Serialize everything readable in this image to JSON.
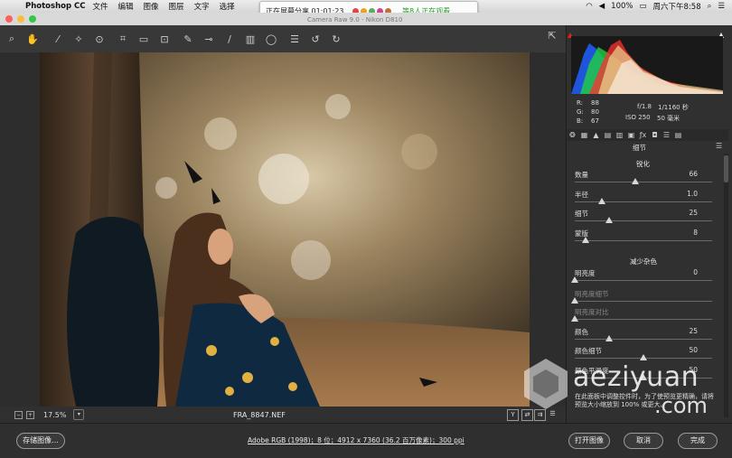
{
  "menubar": {
    "app": "Photoshop CC",
    "items": [
      "文件",
      "编辑",
      "图像",
      "图层",
      "文字",
      "选择"
    ],
    "battery": "100%",
    "clock": "周六下午8:58"
  },
  "share": {
    "text": "正在屏幕分享 01:01:23",
    "viewers": "...等8人正在观看"
  },
  "window": {
    "title": "Camera Raw 9.0 - Nikon D810"
  },
  "toolbar": {
    "tools": [
      "zoom-icon",
      "hand-icon",
      "white-balance-icon",
      "color-sampler-icon",
      "targeted-adjust-icon",
      "crop-icon",
      "straighten-icon",
      "transform-icon",
      "spot-removal-icon",
      "red-eye-icon",
      "adjustment-brush-icon",
      "graduated-filter-icon",
      "radial-filter-icon",
      "presets-list-icon",
      "rotate-left-icon",
      "rotate-right-icon"
    ],
    "fullscreen_icon": "fullscreen-icon"
  },
  "status": {
    "zoom": "17.5%",
    "filename": "FRA_8847.NEF",
    "y_label": "Y"
  },
  "exif": {
    "r_label": "R:",
    "r_val": "88",
    "g_label": "G:",
    "g_val": "80",
    "b_label": "B:",
    "b_val": "67",
    "aperture": "f/1.8",
    "shutter": "1/1160 秒",
    "iso": "ISO 250",
    "focal": "50 毫米"
  },
  "panel": {
    "title": "细节",
    "sharpen_heading": "锐化",
    "noise_heading": "减少杂色",
    "sliders": [
      {
        "name": "数量",
        "value": "66",
        "pos": 0.44
      },
      {
        "name": "半径",
        "value": "1.0",
        "pos": 0.2
      },
      {
        "name": "细节",
        "value": "25",
        "pos": 0.25
      },
      {
        "name": "蒙版",
        "value": "8",
        "pos": 0.08
      }
    ],
    "noise_sliders": [
      {
        "name": "明亮度",
        "value": "0",
        "pos": 0.0,
        "dim": false
      },
      {
        "name": "明亮度细节",
        "value": "",
        "pos": 0.0,
        "dim": true
      },
      {
        "name": "明亮度对比",
        "value": "",
        "pos": 0.0,
        "dim": true
      },
      {
        "name": "颜色",
        "value": "25",
        "pos": 0.25,
        "dim": false
      },
      {
        "name": "颜色细节",
        "value": "50",
        "pos": 0.5,
        "dim": false
      },
      {
        "name": "颜色平滑度",
        "value": "50",
        "pos": 0.5,
        "dim": false
      }
    ],
    "note": "在此面板中调整控件时，为了使预览更精确，请将预览大小缩放到 100% 或更大。"
  },
  "bottom": {
    "save_label": "存储图像...",
    "info": "Adobe RGB (1998)；8 位；4912 x 7360 (36.2 百万像素)；300 ppi",
    "open_label": "打开图像",
    "cancel_label": "取消",
    "done_label": "完成"
  },
  "watermark": {
    "text": "aeziyuan",
    "suffix": ".com"
  }
}
